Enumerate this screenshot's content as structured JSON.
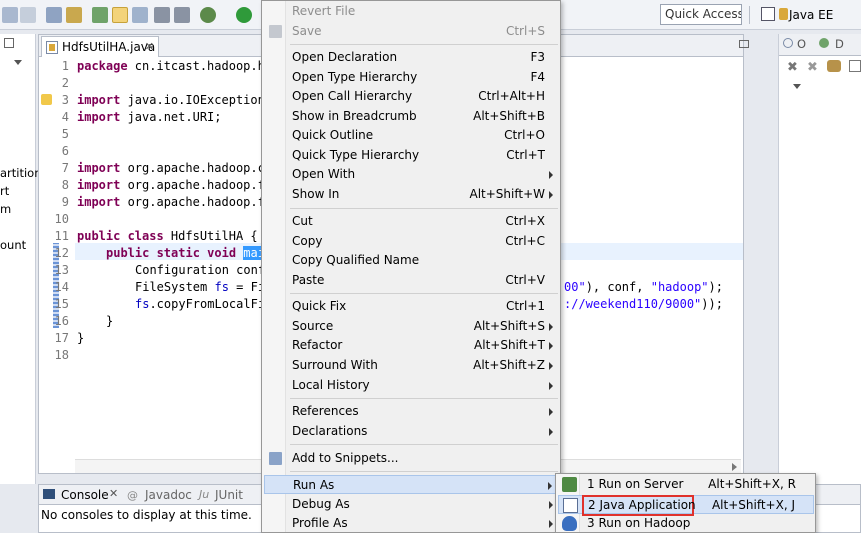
{
  "toolbar": {
    "quick_access_placeholder": "Quick Access",
    "perspective_label": "Java EE",
    "icons": [
      "undo-icon",
      "redo-icon",
      "open-type-icon",
      "debug-icon",
      "highlight-icon",
      "toggle-icon",
      "task-icon",
      "annotation-icon",
      "build-icon",
      "run-icon"
    ]
  },
  "left_pane": {
    "fragments": [
      "artition",
      "rt",
      "m",
      "ount"
    ]
  },
  "editor": {
    "tab_title": "HdfsUtilHA.java",
    "line_numbers": [
      "1",
      "2",
      "3",
      "4",
      "5",
      "6",
      "7",
      "8",
      "9",
      "10",
      "11",
      "12",
      "13",
      "14",
      "15",
      "16",
      "17",
      "18"
    ],
    "code": {
      "l1_kw": "package",
      "l1_text": " cn.itcast.hadoop.h",
      "l3_kw": "import",
      "l3_text": " java.io.IOException",
      "l4_kw": "import",
      "l4_text": " java.net.URI;",
      "l7_kw": "import",
      "l7_text": " org.apache.hadoop.c",
      "l8_kw": "import",
      "l8_text": " org.apache.hadoop.f",
      "l9_kw": "import",
      "l9_text": " org.apache.hadoop.f",
      "l11_kw": "public class",
      "l11_text": " HdfsUtilHA {",
      "l12_kw": "public static void",
      "l12_sel": "mai",
      "l13_text": "Configuration conf",
      "l14_text": "FileSystem ",
      "l14_fld": "fs",
      "l14_rest": " = Fi",
      "l14_tail_str": "00\"",
      "l14_tail_mid": "), conf, ",
      "l14_tail_str2": "\"hadoop\"",
      "l14_tail_end": ");",
      "l15_fld": "fs",
      "l15_text": ".copyFromLocalFi",
      "l15_tail_str": "://weekend110/9000\"",
      "l15_tail_end": "));",
      "l16_text": "}",
      "l17_text": "}"
    }
  },
  "right_pane": {
    "tab1": "O",
    "tab2": "D"
  },
  "console": {
    "tab_active": "Console",
    "tab_javadoc": "Javadoc",
    "tab_junit": "JUnit",
    "message": "No consoles to display at this time."
  },
  "context_menu": {
    "items": [
      {
        "label": "Revert File",
        "shortcut": "",
        "disabled": true
      },
      {
        "label": "Save",
        "shortcut": "Ctrl+S",
        "disabled": true
      },
      {
        "label": "Open Declaration",
        "shortcut": "F3"
      },
      {
        "label": "Open Type Hierarchy",
        "shortcut": "F4"
      },
      {
        "label": "Open Call Hierarchy",
        "shortcut": "Ctrl+Alt+H"
      },
      {
        "label": "Show in Breadcrumb",
        "shortcut": "Alt+Shift+B"
      },
      {
        "label": "Quick Outline",
        "shortcut": "Ctrl+O"
      },
      {
        "label": "Quick Type Hierarchy",
        "shortcut": "Ctrl+T"
      },
      {
        "label": "Open With",
        "shortcut": ""
      },
      {
        "label": "Show In",
        "shortcut": "Alt+Shift+W"
      },
      {
        "label": "Cut",
        "shortcut": "Ctrl+X"
      },
      {
        "label": "Copy",
        "shortcut": "Ctrl+C"
      },
      {
        "label": "Copy Qualified Name",
        "shortcut": ""
      },
      {
        "label": "Paste",
        "shortcut": "Ctrl+V"
      },
      {
        "label": "Quick Fix",
        "shortcut": "Ctrl+1"
      },
      {
        "label": "Source",
        "shortcut": "Alt+Shift+S"
      },
      {
        "label": "Refactor",
        "shortcut": "Alt+Shift+T"
      },
      {
        "label": "Surround With",
        "shortcut": "Alt+Shift+Z"
      },
      {
        "label": "Local History",
        "shortcut": ""
      },
      {
        "label": "References",
        "shortcut": ""
      },
      {
        "label": "Declarations",
        "shortcut": ""
      },
      {
        "label": "Add to Snippets...",
        "shortcut": ""
      },
      {
        "label": "Run As",
        "shortcut": ""
      },
      {
        "label": "Debug As",
        "shortcut": ""
      },
      {
        "label": "Profile As",
        "shortcut": ""
      }
    ]
  },
  "submenu": {
    "items": [
      {
        "label": "1 Run on Server",
        "shortcut": "Alt+Shift+X, R"
      },
      {
        "label": "2 Java Application",
        "shortcut": "Alt+Shift+X, J"
      },
      {
        "label": "3 Run on Hadoop",
        "shortcut": ""
      }
    ],
    "highlight_color": "#e0312b"
  }
}
